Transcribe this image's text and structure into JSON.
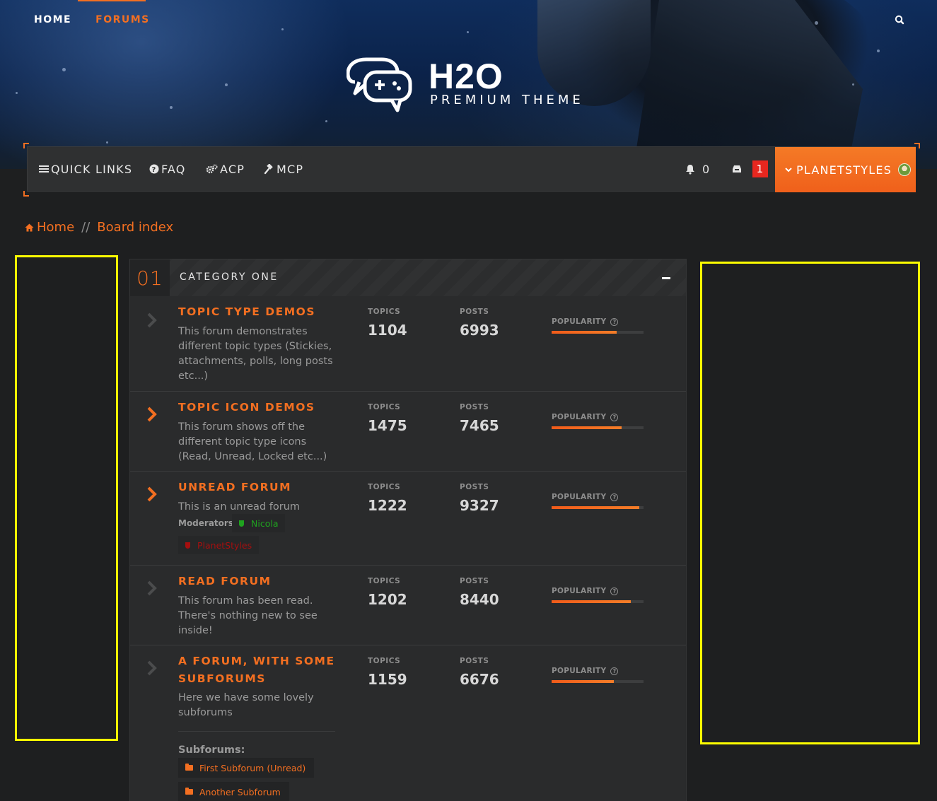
{
  "header": {
    "nav": [
      {
        "label": "HOME",
        "active": false
      },
      {
        "label": "FORUMS",
        "active": true
      }
    ],
    "search_icon": "search-icon",
    "logo": {
      "title": "H2O",
      "subtitle": "PREMIUM THEME",
      "icon": "chat-gamepad-logo"
    }
  },
  "navbar": {
    "quick_links": "QUICK LINKS",
    "faq": "FAQ",
    "acp": "ACP",
    "mcp": "MCP",
    "notifications_count": "0",
    "pm_count": "1",
    "username": "PLANETSTYLES"
  },
  "breadcrumb": {
    "home": "Home",
    "separator": "//",
    "current": "Board index"
  },
  "category": {
    "number": "01",
    "title": "CATEGORY ONE",
    "collapse_icon": "minus-icon",
    "labels": {
      "topics": "TOPICS",
      "posts": "POSTS",
      "popularity": "POPULARITY"
    },
    "forums": [
      {
        "title_lines": [
          "TOPIC TYPE DEMOS"
        ],
        "description": "This forum demonstrates different topic types (Stickies, attachments, polls, long posts etc...)",
        "unread": false,
        "topics": "1104",
        "posts": "6993",
        "popularity": 0.71
      },
      {
        "title_lines": [
          "TOPIC ICON DEMOS"
        ],
        "description": "This forum shows off the different topic type icons (Read, Unread, Locked etc...)",
        "unread": true,
        "topics": "1475",
        "posts": "7465",
        "popularity": 0.76
      },
      {
        "title_lines": [
          "UNREAD FORUM"
        ],
        "description": "This is an unread forum",
        "unread": true,
        "topics": "1222",
        "posts": "9327",
        "popularity": 0.95,
        "moderators_label": "Moderators:",
        "moderators": [
          {
            "name": "Nicola",
            "color": "#1fa31f"
          },
          {
            "name": "PlanetStyles",
            "color": "#a50f0f"
          }
        ]
      },
      {
        "title_lines": [
          "READ FORUM"
        ],
        "description": "This forum has been read. There's nothing new to see inside!",
        "unread": false,
        "topics": "1202",
        "posts": "8440",
        "popularity": 0.86
      },
      {
        "title_lines": [
          "A FORUM, WITH SOME",
          "SUBFORUMS"
        ],
        "description": "Here we have some lovely subforums",
        "unread": false,
        "topics": "1159",
        "posts": "6676",
        "popularity": 0.68,
        "subforums_label": "Subforums:",
        "subforums": [
          "First Subforum (Unread)",
          "Another Subforum"
        ]
      }
    ]
  },
  "colors": {
    "accent": "#f36f21",
    "background": "#1e1f20",
    "panel": "#2a2b2c",
    "highlight_border": "#ffff00",
    "badge_red": "#e8271f"
  }
}
